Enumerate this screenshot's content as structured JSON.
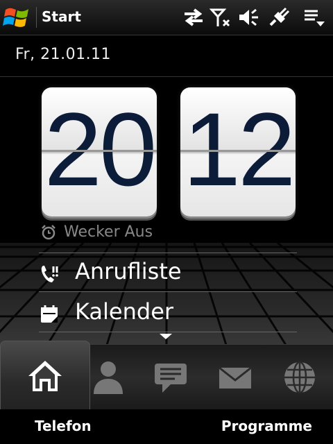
{
  "statusbar": {
    "title": "Start",
    "icons": [
      "data-sync-icon",
      "no-signal-antenna-icon",
      "volume-off-icon",
      "charging-plug-icon",
      "menu-dropdown-icon"
    ]
  },
  "home": {
    "date": "Fr, 21.01.11",
    "clock": {
      "hours": "20",
      "minutes": "12"
    },
    "alarm_label": "Wecker Aus",
    "list": [
      {
        "label": "Anrufliste",
        "icon": "call-history-icon"
      },
      {
        "label": "Kalender",
        "icon": "calendar-icon"
      }
    ]
  },
  "tabs": [
    {
      "name": "home-tab",
      "icon": "home-icon",
      "active": true
    },
    {
      "name": "contacts-tab",
      "icon": "person-icon",
      "active": false
    },
    {
      "name": "messages-tab",
      "icon": "message-bubble-icon",
      "active": false
    },
    {
      "name": "mail-tab",
      "icon": "envelope-icon",
      "active": false
    },
    {
      "name": "internet-tab",
      "icon": "globe-icon",
      "active": false
    }
  ],
  "softkeys": {
    "left": "Telefon",
    "right": "Programme"
  },
  "colors": {
    "clock_digits": "#0c1d3a",
    "background": "#000000",
    "muted_text": "#888888"
  }
}
